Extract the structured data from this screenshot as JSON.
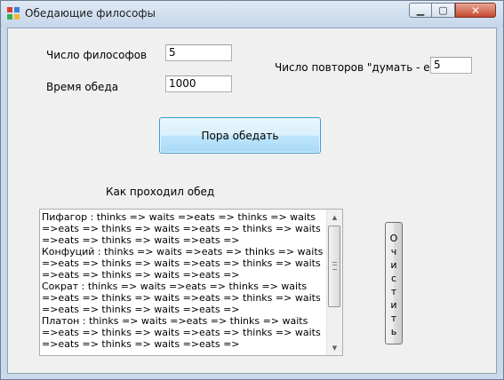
{
  "window": {
    "title": "Обедающие философы",
    "controls": {
      "minimize": "▁",
      "maximize": "▢",
      "close": "✕"
    }
  },
  "form": {
    "philosophers_label": "Число философов",
    "philosophers_value": "5",
    "lunch_time_label": "Время обеда",
    "lunch_time_value": "1000",
    "repeats_label": "Число повторов \"думать - есть\"",
    "repeats_value": "5",
    "dine_button": "Пора обедать",
    "log_label": "Как проходил обед",
    "clear_button_letters": [
      "О",
      "ч",
      "и",
      "с",
      "т",
      "и",
      "т",
      "ь"
    ]
  },
  "log": {
    "entries": [
      "Пифагор : thinks => waits =>eats => thinks => waits =>eats => thinks => waits =>eats => thinks => waits =>eats => thinks => waits =>eats =>",
      "Конфуций : thinks => waits =>eats => thinks => waits =>eats => thinks => waits =>eats => thinks => waits =>eats => thinks => waits =>eats =>",
      "Сократ : thinks => waits =>eats => thinks => waits =>eats => thinks => waits =>eats => thinks => waits =>eats => thinks => waits =>eats =>",
      "Платон : thinks => waits =>eats => thinks => waits =>eats => thinks => waits =>eats => thinks => waits =>eats => thinks => waits =>eats =>"
    ]
  },
  "icons": {
    "app": "app-icon",
    "scroll_up": "▲",
    "scroll_down": "▼"
  },
  "colors": {
    "titlebar": "#c5d6ea",
    "client_bg": "#f0f0f0",
    "button_accent": "#3c9fd4",
    "close_button": "#c7472d"
  }
}
